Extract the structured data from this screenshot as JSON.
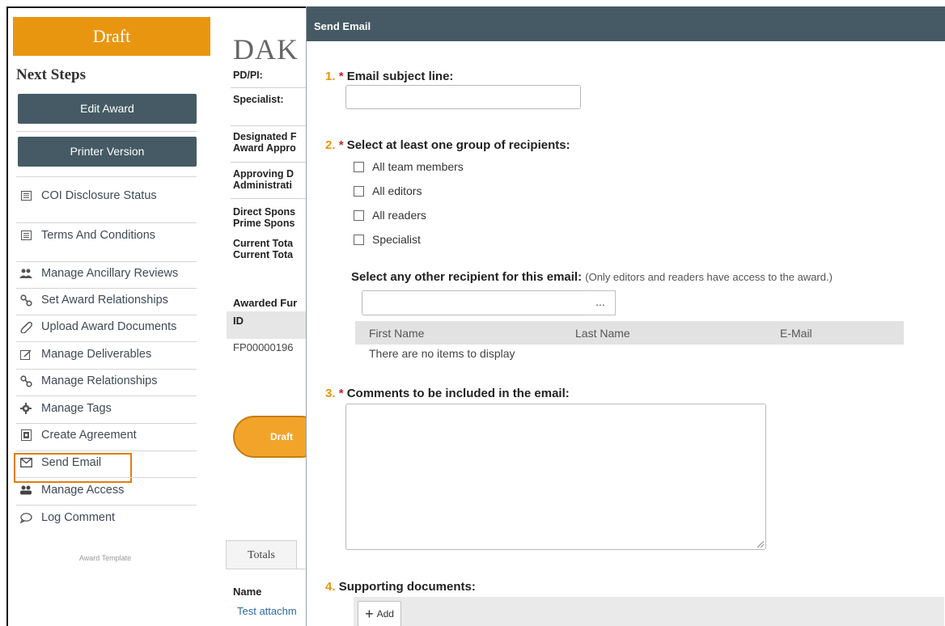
{
  "sidebar": {
    "status_banner": "Draft",
    "next_steps_title": "Next Steps",
    "edit_award_button": "Edit Award",
    "printer_version_button": "Printer Version",
    "items": [
      {
        "label": "COI Disclosure Status",
        "icon": "list-icon"
      },
      {
        "label": "Terms And Conditions",
        "icon": "list-icon"
      },
      {
        "label": "Manage Ancillary Reviews",
        "icon": "people-icon"
      },
      {
        "label": "Set Award Relationships",
        "icon": "relationship-icon"
      },
      {
        "label": "Upload Award Documents",
        "icon": "paperclip-icon"
      },
      {
        "label": "Manage Deliverables",
        "icon": "edit-icon"
      },
      {
        "label": "Manage Relationships",
        "icon": "relationship-icon"
      },
      {
        "label": "Manage Tags",
        "icon": "gear-icon"
      },
      {
        "label": "Create Agreement",
        "icon": "agreement-icon"
      },
      {
        "label": "Send Email",
        "icon": "envelope-icon"
      },
      {
        "label": "Manage Access",
        "icon": "users-icon"
      },
      {
        "label": "Log Comment",
        "icon": "comment-icon"
      }
    ],
    "template_label": "Award Template"
  },
  "background": {
    "title": "DAK",
    "fields": [
      {
        "label": "PD/PI:"
      },
      {
        "label": "Specialist:"
      },
      {
        "label": "Designated F\nAward Appro"
      },
      {
        "label": "Approving D\nAdministrati"
      },
      {
        "label": "Direct Spons\nPrime Spons"
      },
      {
        "label": "Current Tota\nCurrent Tota"
      }
    ],
    "awarded_funding_label": "Awarded Fur",
    "id_header": "ID",
    "id_value": "FP00000196",
    "draft_pill": "Draft",
    "totals_tab": "Totals",
    "name_header": "Name",
    "attachment_link": "Test attachm"
  },
  "modal": {
    "title": "Send Email",
    "q1": {
      "number": "1.",
      "required": "*",
      "label": "Email subject line:",
      "value": ""
    },
    "q2": {
      "number": "2.",
      "required": "*",
      "label": "Select at least one group of recipients:",
      "options": [
        {
          "label": "All team members",
          "checked": false
        },
        {
          "label": "All editors",
          "checked": false
        },
        {
          "label": "All readers",
          "checked": false
        },
        {
          "label": "Specialist",
          "checked": false
        }
      ]
    },
    "other_recipient": {
      "label": "Select any other recipient for this email:",
      "note": "(Only editors and readers have access to the award.)",
      "value": "",
      "browse_button": "...",
      "columns": [
        "First Name",
        "Last Name",
        "E-Mail"
      ],
      "empty_text": "There are no items to display"
    },
    "q3": {
      "number": "3.",
      "required": "*",
      "label": "Comments to be included in the email:",
      "value": ""
    },
    "q4": {
      "number": "4.",
      "label": "Supporting documents:",
      "add_button": "Add"
    }
  },
  "colors": {
    "accent": "#e8960f",
    "header": "#455a64",
    "highlight": "#e07d14",
    "required": "#c0282f"
  }
}
